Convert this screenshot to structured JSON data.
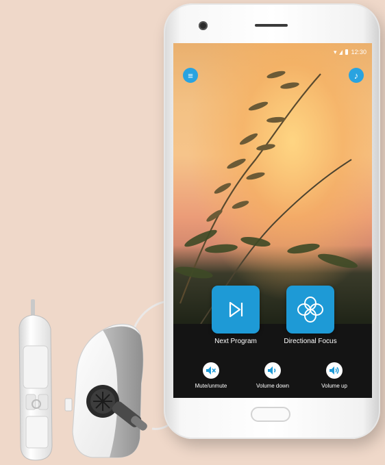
{
  "status_bar": {
    "time": "12:30"
  },
  "screen": {
    "menu_icon": "menu-icon",
    "music_icon": "music-note-icon",
    "actions": [
      {
        "label": "Next Program",
        "icon": "skip-next-icon"
      },
      {
        "label": "Directional Focus",
        "icon": "directional-focus-icon"
      }
    ],
    "controls": [
      {
        "label": "Mute/unmute",
        "icon": "speaker-mute-icon"
      },
      {
        "label": "Volume down",
        "icon": "volume-down-icon"
      },
      {
        "label": "Volume up",
        "icon": "volume-up-icon"
      }
    ]
  },
  "colors": {
    "background": "#efd8c9",
    "accent": "#1e9ad6",
    "screen_bottom": "#141414"
  }
}
